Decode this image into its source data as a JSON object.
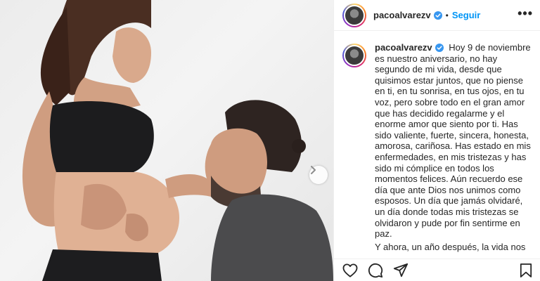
{
  "post": {
    "username": "pacoalvarezv",
    "follow_label": "Seguir",
    "more_label": "•••",
    "separator": "•",
    "caption_paragraphs": [
      "Hoy 9 de noviembre es nuestro aniversario, no hay segundo de mi vida, desde que quisimos estar juntos, que no piense en ti, en tu sonrisa, en tus ojos, en tu voz, pero sobre todo en el gran amor que has decidido regalarme y el enorme amor que siento por ti. Has sido valiente, fuerte, sincera, honesta, amorosa, cariñosa. Has estado en mis enfermedades, en mis tristezas y has sido mi cómplice en todos los momentos felices. Aún recuerdo ese día que ante Dios nos unimos como esposos. Un día que jamás olvidaré, un día donde todas mis tristezas se olvidaron y pude por fin sentirme en paz.",
      "Y ahora, un año después, la vida nos"
    ]
  },
  "icons": {
    "verified": "verified-badge-icon",
    "like": "heart-icon",
    "comment": "comment-icon",
    "share": "paper-plane-icon",
    "save": "bookmark-icon",
    "next": "chevron-right-icon"
  },
  "colors": {
    "link_blue": "#0095f6",
    "verified_blue": "#3897f0",
    "text": "#262626",
    "border": "#efefef"
  }
}
